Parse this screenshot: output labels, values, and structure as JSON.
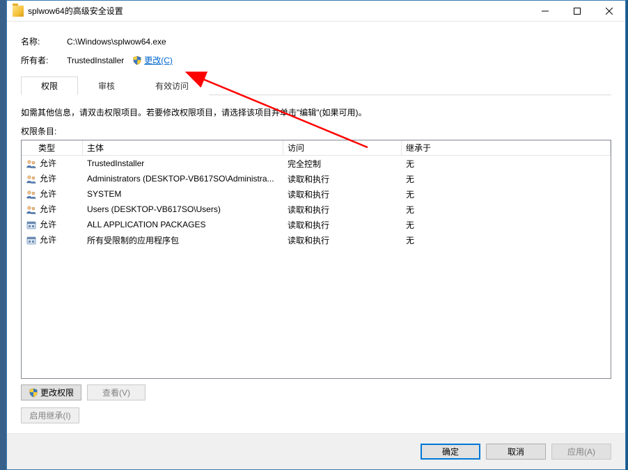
{
  "window": {
    "title": "splwow64的高级安全设置"
  },
  "meta": {
    "name_label": "名称:",
    "name_value": "C:\\Windows\\splwow64.exe",
    "owner_label": "所有者:",
    "owner_value": "TrustedInstaller",
    "change_link": "更改(C)"
  },
  "tabs": {
    "permissions": "权限",
    "audit": "审核",
    "effective": "有效访问"
  },
  "hint": "如需其他信息，请双击权限项目。若要修改权限项目，请选择该项目并单击\"编辑\"(如果可用)。",
  "entries_label": "权限条目:",
  "columns": {
    "type": "类型",
    "principal": "主体",
    "access": "访问",
    "inherit": "继承于"
  },
  "rows": [
    {
      "icon": "user",
      "type": "允许",
      "principal": "TrustedInstaller",
      "access": "完全控制",
      "inherit": "无"
    },
    {
      "icon": "user",
      "type": "允许",
      "principal": "Administrators (DESKTOP-VB617SO\\Administra...",
      "access": "读取和执行",
      "inherit": "无"
    },
    {
      "icon": "user",
      "type": "允许",
      "principal": "SYSTEM",
      "access": "读取和执行",
      "inherit": "无"
    },
    {
      "icon": "user",
      "type": "允许",
      "principal": "Users (DESKTOP-VB617SO\\Users)",
      "access": "读取和执行",
      "inherit": "无"
    },
    {
      "icon": "pkg",
      "type": "允许",
      "principal": "ALL APPLICATION PACKAGES",
      "access": "读取和执行",
      "inherit": "无"
    },
    {
      "icon": "pkg",
      "type": "允许",
      "principal": "所有受限制的应用程序包",
      "access": "读取和执行",
      "inherit": "无"
    }
  ],
  "buttons": {
    "change_perm": "更改权限",
    "view": "查看(V)",
    "enable_inherit": "启用继承(I)",
    "ok": "确定",
    "cancel": "取消",
    "apply": "应用(A)"
  }
}
